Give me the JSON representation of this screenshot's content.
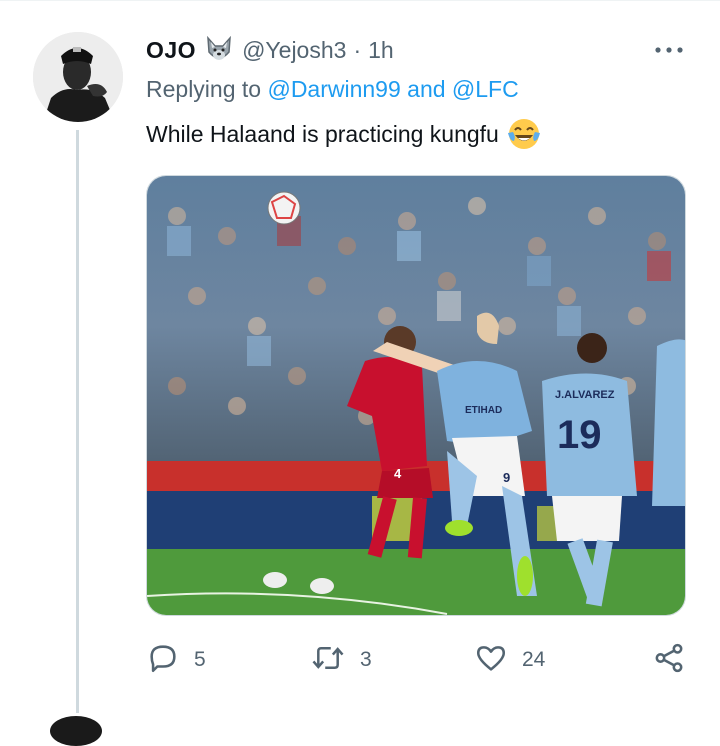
{
  "tweet": {
    "author_name": "OJO",
    "author_handle": "@Yejosh3",
    "separator": "·",
    "time": "1h",
    "replying_prefix": "Replying to",
    "reply_to_1": "@Darwinn99",
    "reply_and": "and",
    "reply_to_2": "@LFC",
    "text": "While Halaand is practicing kungfu",
    "emoji": "face-with-tears-of-joy",
    "name_badge_icon": "wolf-emoji-icon",
    "media": {
      "description_icon": "football-match-photo",
      "left_jersey_number": "4",
      "right_jersey_number": "9",
      "back_jersey_name": "J.ALVAREZ",
      "back_jersey_number": "19",
      "shirt_sponsor": "ETIHAD"
    }
  },
  "actions": {
    "reply_count": "5",
    "retweet_count": "3",
    "like_count": "24"
  },
  "colors": {
    "link": "#1d9bf0",
    "secondary_text": "#536471",
    "primary_text": "#0f1419",
    "thread_line": "#cfd9de"
  }
}
